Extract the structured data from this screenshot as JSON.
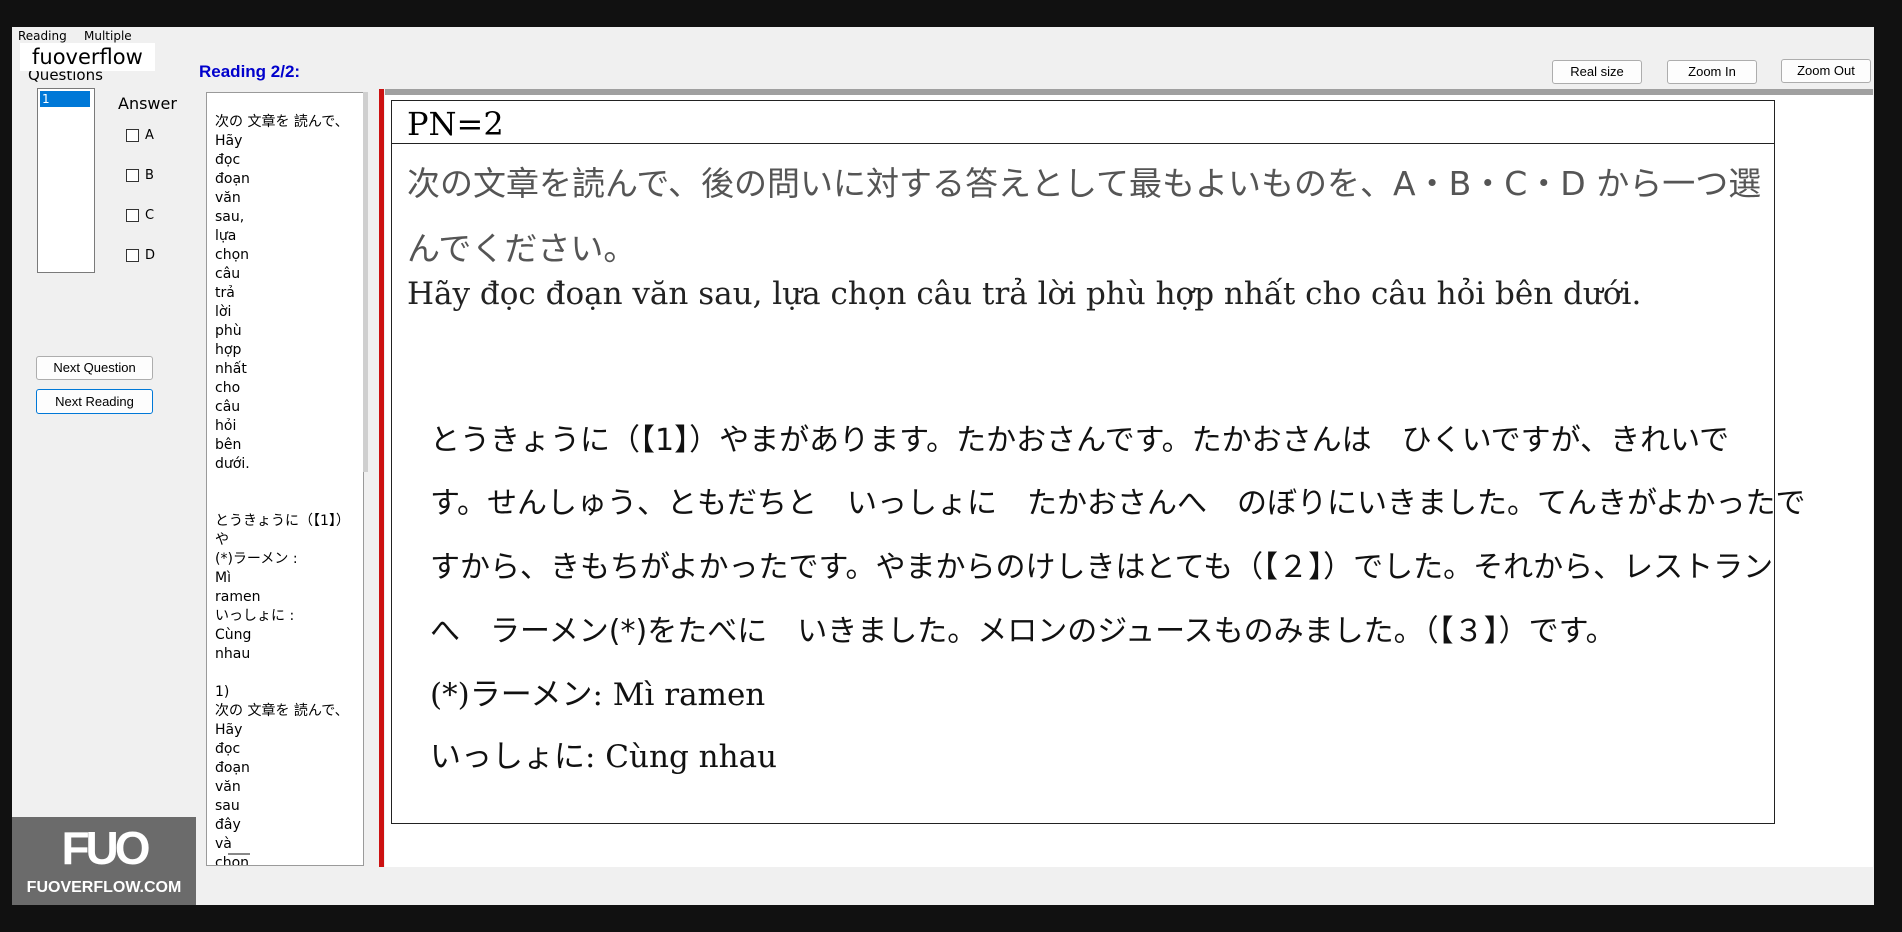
{
  "tabs": [
    "Reading",
    "Multiple Choices"
  ],
  "watermark_top": "fuoverflow",
  "questions": {
    "label": "Questions",
    "items": [
      "1"
    ]
  },
  "answer": {
    "label": "Answer",
    "options": [
      "A",
      "B",
      "C",
      "D"
    ]
  },
  "buttons": {
    "next_question": "Next Question",
    "next_reading": "Next Reading",
    "real_size": "Real size",
    "zoom_in": "Zoom In",
    "zoom_out": "Zoom Out"
  },
  "reading_label": "Reading 2/2:",
  "left_panel_text": "次の 文章を 読んで、\nHãy\nđọc\nđoạn\nvăn\nsau,\nlựa\nchọn\ncâu\ntrả\nlời\nphù\nhợp\nnhất\ncho\ncâu\nhỏi\nbên\ndưới.\n\n\nとうきょうに（【1】）や\n(*)ラーメン :\nMì\nramen\nいっしょに :\nCùng\nnhau\n\n1)\n次の 文章を 読んで、\nHãy\nđọc\nđoạn\nvăn\nsau\nđây\nvà\nchọn",
  "document": {
    "pn": "PN=2",
    "instruction_jp": "次の文章を読んで、後の問いに対する答えとして最もよいものを、A・B・C・D から一つ選んでください。",
    "instruction_vi": "Hãy đọc đoạn văn sau, lựa chọn câu trả lời phù hợp nhất cho câu hỏi bên dưới.",
    "passage_lines": [
      "とうきょうに（【1】）やまがあります。たかおさんです。たかおさんは　ひくいですが、きれいで",
      "す。せんしゅう、ともだちと　いっしょに　たかおさんへ　のぼりにいきました。てんきがよかったで",
      "すから、きもちがよかったです。やまからのけしきはとても（【２】）でした。それから、レストラン",
      "へ　ラーメン(*)をたべに　いきました。メロンのジュースものみました。（【３】）です。"
    ],
    "glosses": [
      "(*)ラーメン: Mì ramen",
      "いっしょに: Cùng nhau"
    ]
  },
  "logo": {
    "big": "FUO",
    "small": "FUOVERFLOW.COM"
  }
}
